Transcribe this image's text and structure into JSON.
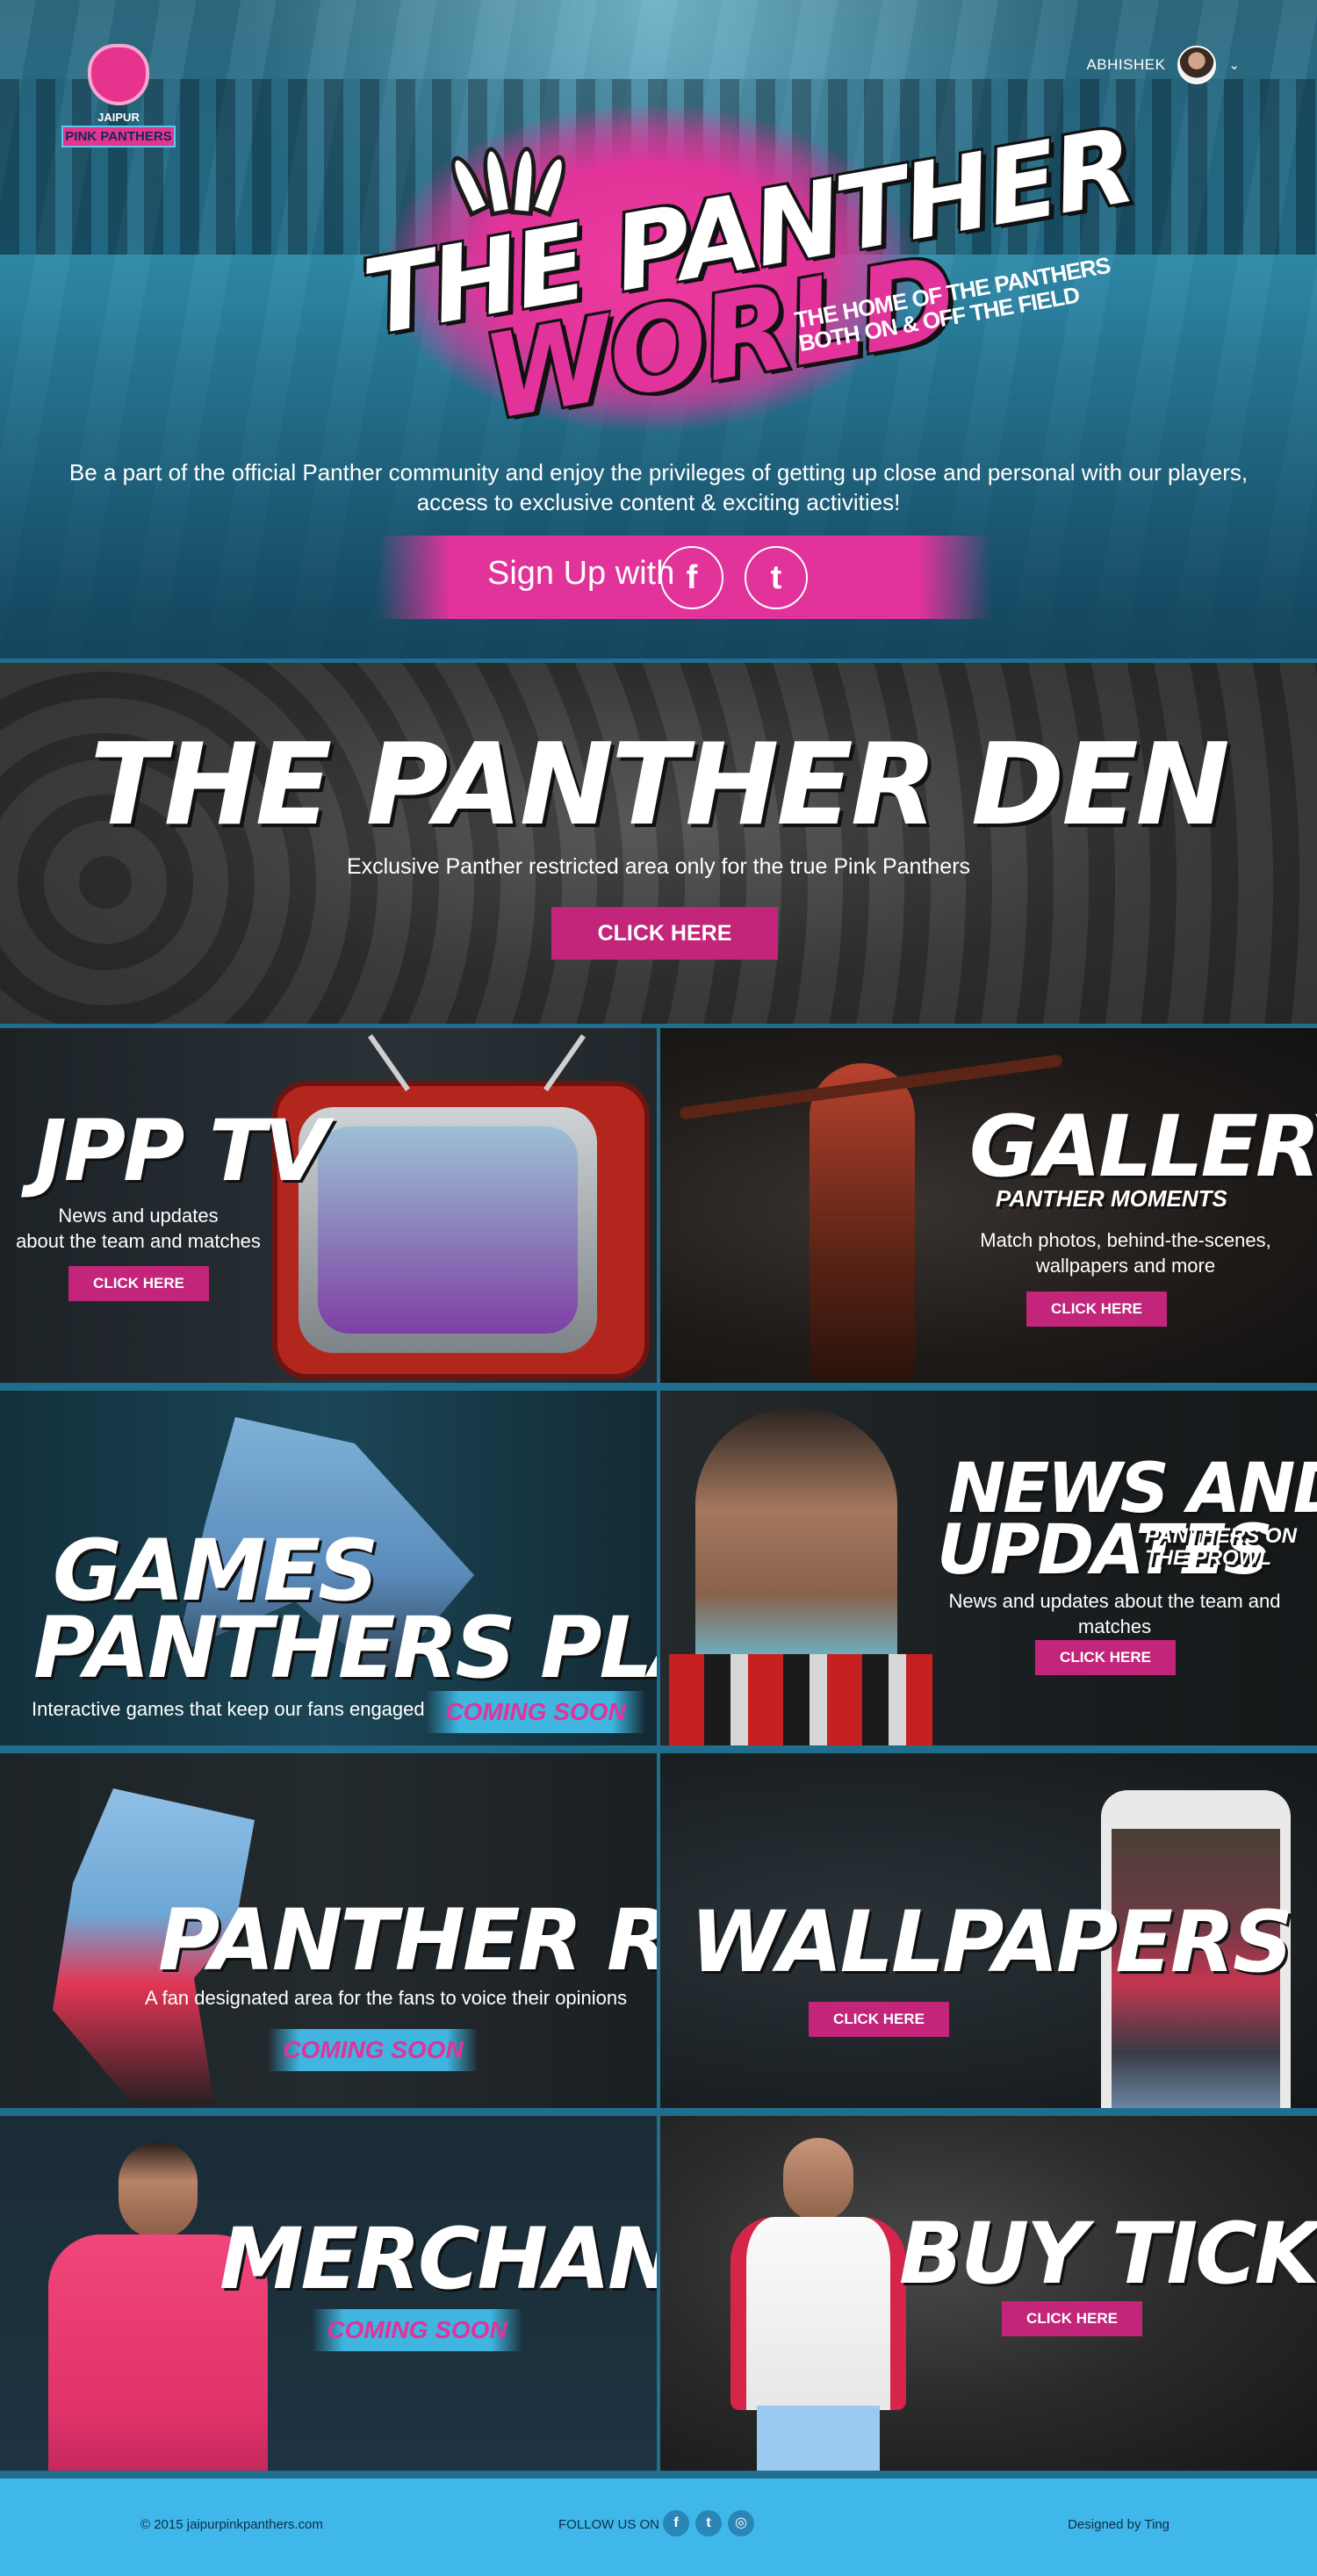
{
  "header": {
    "logo_line1": "JAIPUR",
    "logo_line2": "PINK PANTHERS",
    "user_name": "ABHISHEK"
  },
  "hero": {
    "title_line1": "THE PANTHER",
    "title_line2": "WORLD",
    "tagline_line1": "THE HOME OF THE PANTHERS",
    "tagline_line2": "BOTH ON & OFF THE FIELD",
    "description_line1": "Be a part of the official Panther community and enjoy the privileges of getting up close and personal with our players,",
    "description_line2": "access to exclusive content & exciting activities!",
    "signup_label": "Sign Up with",
    "facebook_glyph": "f",
    "twitter_glyph": "t"
  },
  "den": {
    "title": "THE PANTHER DEN",
    "subtitle": "Exclusive Panther restricted area only for the true Pink Panthers",
    "button": "CLICK HERE"
  },
  "tiles": {
    "jpptv": {
      "title": "JPP TV",
      "desc1": "News and updates",
      "desc2": "about the team and matches",
      "button": "CLICK HERE"
    },
    "gallery": {
      "title": "GALLERY",
      "sub": "PANTHER MOMENTS",
      "desc1": "Match photos, behind-the-scenes,",
      "desc2": "wallpapers and more",
      "button": "CLICK HERE"
    },
    "games": {
      "title1": "GAMES",
      "title2": "PANTHERS PLAY",
      "desc": "Interactive games that keep our fans engaged",
      "badge": "COMING SOON"
    },
    "news": {
      "title1": "NEWS AND",
      "title2": "UPDATES",
      "sub1": "PANTHERS ON",
      "sub2": "THE PROWL",
      "desc": "News and updates about the team and matches",
      "button": "CLICK HERE"
    },
    "room": {
      "title": "PANTHER ROOM",
      "desc": "A fan designated area for the fans to voice their opinions",
      "badge": "COMING SOON"
    },
    "wallpapers": {
      "title": "WALLPAPERS",
      "button": "CLICK HERE"
    },
    "merch": {
      "title": "MERCHANDISE",
      "badge": "COMING SOON"
    },
    "tickets": {
      "title": "BUY TICKETS",
      "button": "CLICK HERE"
    }
  },
  "footer": {
    "copyright": "© 2015 jaipurpinkpanthers.com",
    "follow": "FOLLOW US ON",
    "designed": "Designed by Ting",
    "icon_fb": "f",
    "icon_tw": "t",
    "icon_ig": "◎"
  },
  "colors": {
    "pink": "#e2339a",
    "button_pink": "#c2257a",
    "cyan": "#3fb7ea",
    "border_blue": "#1f6e8d"
  }
}
